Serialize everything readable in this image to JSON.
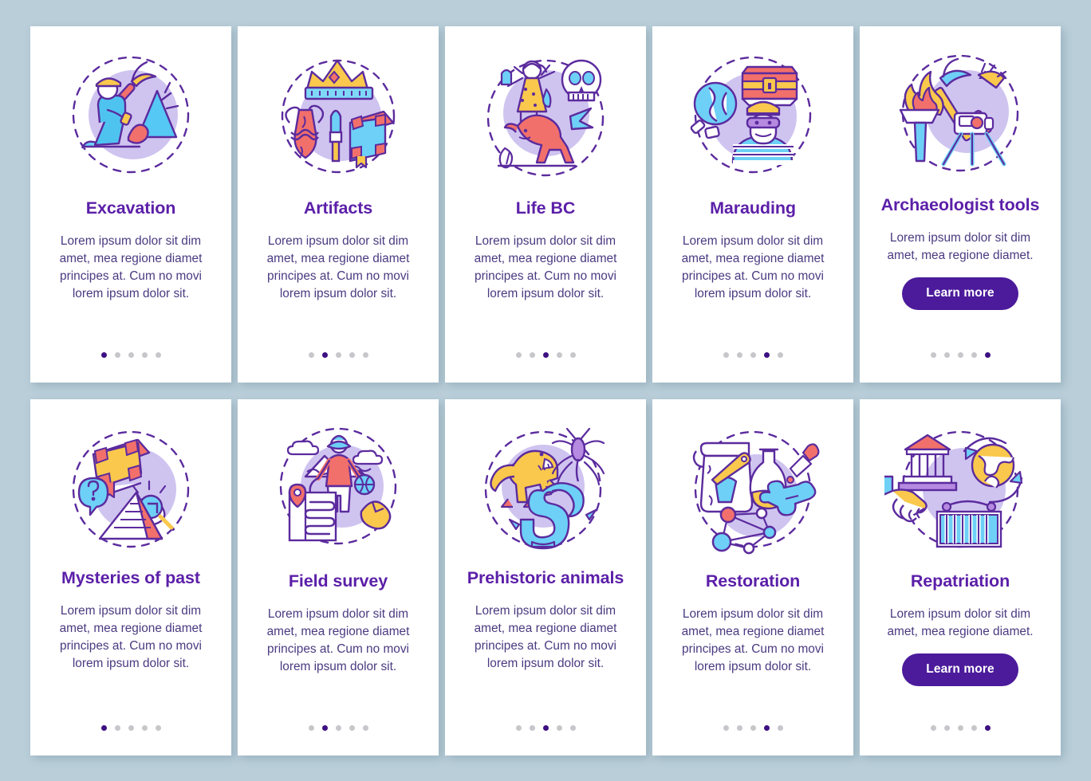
{
  "theme": {
    "background": "#b9ced9",
    "card_background": "#ffffff",
    "title_color": "#5b1fa8",
    "body_color": "#4a3a80",
    "button_color": "#4b1b9b",
    "button_text_color": "#ffffff",
    "dot_active_color": "#3d1082",
    "dot_inactive_color": "#c7c7cb",
    "illustration_circle_color": "#cfc4f0"
  },
  "common": {
    "body_long": "Lorem ipsum dolor sit dim amet, mea regione diamet principes at. Cum no movi lorem ipsum dolor sit.",
    "body_short": "Lorem ipsum dolor sit dim amet, mea regione diamet.",
    "learn_more_label": "Learn more",
    "dots_total": 5
  },
  "cards": [
    {
      "title": "Excavation",
      "body": "Lorem ipsum dolor sit dim amet, mea regione diamet principes at. Cum no movi lorem ipsum dolor sit.",
      "has_button": false,
      "button_label": "",
      "dots_total": 5,
      "dot_active": 1,
      "illustration": "excavation-icon",
      "illustration_elements": [
        "archaeologist-kneeling",
        "hard-hat",
        "pickaxe",
        "rock-mountain",
        "dashed-circle"
      ]
    },
    {
      "title": "Artifacts",
      "body": "Lorem ipsum dolor sit dim amet, mea regione diamet principes at. Cum no movi lorem ipsum dolor sit.",
      "has_button": false,
      "button_label": "",
      "dots_total": 5,
      "dot_active": 2,
      "illustration": "artifacts-icon",
      "illustration_elements": [
        "crown",
        "amphora-vase",
        "spear-point",
        "ancient-book",
        "dashed-circle"
      ]
    },
    {
      "title": "Life BC",
      "body": "Lorem ipsum dolor sit dim amet, mea regione diamet principes at. Cum no movi lorem ipsum dolor sit.",
      "has_button": false,
      "button_label": "",
      "dots_total": 5,
      "dot_active": 3,
      "illustration": "life-bc-icon",
      "illustration_elements": [
        "caveman",
        "skull",
        "pterodactyl",
        "tyrannosaurus",
        "feather",
        "dashed-circle"
      ]
    },
    {
      "title": "Marauding",
      "body": "Lorem ipsum dolor sit dim amet, mea regione diamet principes at. Cum no movi lorem ipsum dolor sit.",
      "has_button": false,
      "button_label": "",
      "dots_total": 5,
      "dot_active": 4,
      "illustration": "marauding-icon",
      "illustration_elements": [
        "treasure-chest",
        "broken-magnifier",
        "masked-robber",
        "striped-shirt",
        "dashed-circle"
      ]
    },
    {
      "title": "Archaeologist tools",
      "body": "Lorem ipsum dolor sit dim amet, mea regione diamet.",
      "has_button": true,
      "button_label": "Learn more",
      "dots_total": 5,
      "dot_active": 5,
      "illustration": "archaeologist-tools-icon",
      "illustration_elements": [
        "torch-flame",
        "pickaxe",
        "brush",
        "survey-camera-tripod",
        "dashed-circle"
      ]
    },
    {
      "title": "Mysteries of past",
      "body": "Lorem ipsum dolor sit dim amet, mea regione diamet principes at. Cum no movi lorem ipsum dolor sit.",
      "has_button": false,
      "button_label": "",
      "dots_total": 5,
      "dot_active": 1,
      "illustration": "mysteries-of-past-icon",
      "illustration_elements": [
        "ancient-book",
        "question-speech-bubble",
        "eye-magnifier",
        "pyramid",
        "dashed-circle"
      ]
    },
    {
      "title": "Field survey",
      "body": "Lorem ipsum dolor sit dim amet, mea regione diamet principes at. Cum no movi lorem ipsum dolor sit.",
      "has_button": false,
      "button_label": "",
      "dots_total": 5,
      "dot_active": 2,
      "illustration": "field-survey-icon",
      "illustration_elements": [
        "explorer-with-hat",
        "clouds",
        "rope",
        "map-document-with-pin",
        "land-map",
        "dashed-circle"
      ]
    },
    {
      "title": "Prehistoric animals",
      "body": "Lorem ipsum dolor sit dim amet, mea regione diamet principes at. Cum no movi lorem ipsum dolor sit.",
      "has_button": false,
      "button_label": "",
      "dots_total": 5,
      "dot_active": 3,
      "illustration": "prehistoric-animals-icon",
      "illustration_elements": [
        "yellow-tyrannosaurus",
        "giant-mosquito",
        "blue-dragon",
        "dashed-circle"
      ]
    },
    {
      "title": "Restoration",
      "body": "Lorem ipsum dolor sit dim amet, mea regione diamet principes at. Cum no movi lorem ipsum dolor sit.",
      "has_button": false,
      "button_label": "",
      "dots_total": 5,
      "dot_active": 4,
      "illustration": "restoration-icon",
      "illustration_elements": [
        "cracked-vase",
        "paint-brush",
        "flask",
        "bones",
        "pipette-dropper",
        "molecule-network",
        "dashed-circle"
      ]
    },
    {
      "title": "Repatriation",
      "body": "Lorem ipsum dolor sit dim amet, mea regione diamet.",
      "has_button": true,
      "button_label": "Learn more",
      "dots_total": 5,
      "dot_active": 5,
      "illustration": "repatriation-icon",
      "illustration_elements": [
        "museum-building",
        "handshake",
        "globe-with-arrows",
        "shipping-container",
        "dashed-circle"
      ]
    }
  ]
}
